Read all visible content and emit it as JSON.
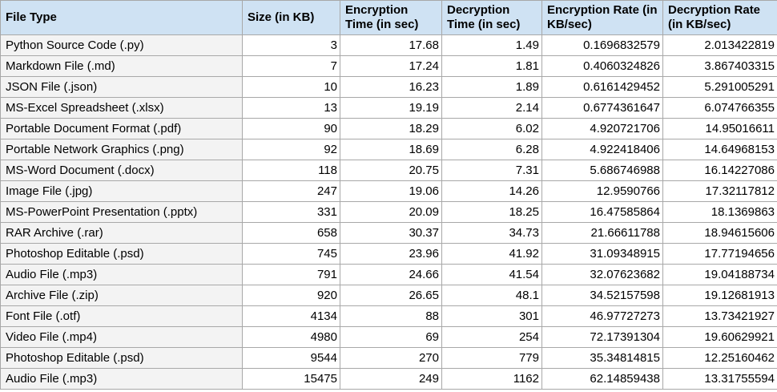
{
  "columns": [
    "File Type",
    "Size (in KB)",
    "Encryption Time (in sec)",
    "Decryption Time (in sec)",
    "Encryption Rate (in KB/sec)",
    "Decryption Rate (in KB/sec)"
  ],
  "rows": [
    [
      "Python Source Code (.py)",
      "3",
      "17.68",
      "1.49",
      "0.1696832579",
      "2.013422819"
    ],
    [
      "Markdown File (.md)",
      "7",
      "17.24",
      "1.81",
      "0.4060324826",
      "3.867403315"
    ],
    [
      "JSON File (.json)",
      "10",
      "16.23",
      "1.89",
      "0.6161429452",
      "5.291005291"
    ],
    [
      "MS-Excel Spreadsheet (.xlsx)",
      "13",
      "19.19",
      "2.14",
      "0.6774361647",
      "6.074766355"
    ],
    [
      "Portable Document Format (.pdf)",
      "90",
      "18.29",
      "6.02",
      "4.920721706",
      "14.95016611"
    ],
    [
      "Portable Network Graphics (.png)",
      "92",
      "18.69",
      "6.28",
      "4.922418406",
      "14.64968153"
    ],
    [
      "MS-Word Document (.docx)",
      "118",
      "20.75",
      "7.31",
      "5.686746988",
      "16.14227086"
    ],
    [
      "Image File (.jpg)",
      "247",
      "19.06",
      "14.26",
      "12.9590766",
      "17.32117812"
    ],
    [
      "MS-PowerPoint Presentation (.pptx)",
      "331",
      "20.09",
      "18.25",
      "16.47585864",
      "18.1369863"
    ],
    [
      "RAR Archive (.rar)",
      "658",
      "30.37",
      "34.73",
      "21.66611788",
      "18.94615606"
    ],
    [
      "Photoshop Editable (.psd)",
      "745",
      "23.96",
      "41.92",
      "31.09348915",
      "17.77194656"
    ],
    [
      "Audio File (.mp3)",
      "791",
      "24.66",
      "41.54",
      "32.07623682",
      "19.04188734"
    ],
    [
      "Archive File (.zip)",
      "920",
      "26.65",
      "48.1",
      "34.52157598",
      "19.12681913"
    ],
    [
      "Font File (.otf)",
      "4134",
      "88",
      "301",
      "46.97727273",
      "13.73421927"
    ],
    [
      "Video File (.mp4)",
      "4980",
      "69",
      "254",
      "72.17391304",
      "19.60629921"
    ],
    [
      "Photoshop Editable (.psd)",
      "9544",
      "270",
      "779",
      "35.34814815",
      "12.25160462"
    ],
    [
      "Audio File (.mp3)",
      "15475",
      "249",
      "1162",
      "62.14859438",
      "13.31755594"
    ]
  ]
}
